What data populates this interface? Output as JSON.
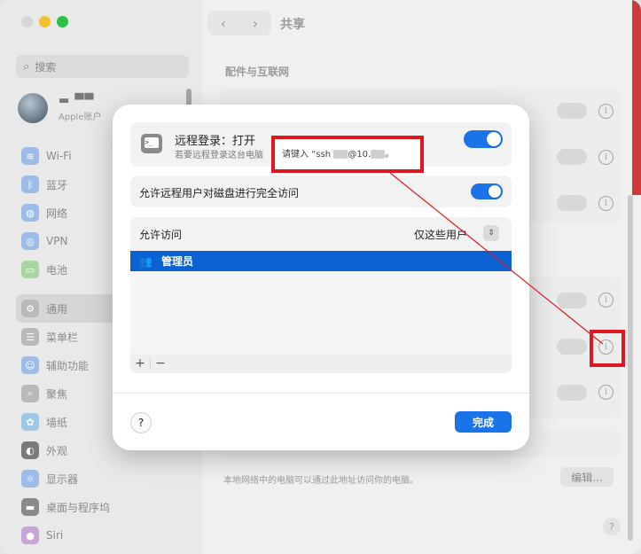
{
  "window": {
    "title": "共享",
    "nav_back": "‹",
    "nav_forward": "›"
  },
  "sidebar": {
    "search_placeholder": "搜索",
    "account_name": "▬ ▀▀",
    "account_sub": "Apple账户",
    "items": [
      {
        "label": "Wi-Fi",
        "icon": "wifi-icon",
        "color": "#9dbde8"
      },
      {
        "label": "蓝牙",
        "icon": "bluetooth-icon",
        "color": "#9dbde8"
      },
      {
        "label": "网络",
        "icon": "globe-icon",
        "color": "#9dbde8"
      },
      {
        "label": "VPN",
        "icon": "vpn-icon",
        "color": "#9dbde8"
      },
      {
        "label": "电池",
        "icon": "battery-icon",
        "color": "#a9d6a0"
      },
      {
        "label": "通用",
        "icon": "gear-icon",
        "color": "#b9b9b9",
        "active": true
      },
      {
        "label": "菜单栏",
        "icon": "menubar-icon",
        "color": "#b9b9b9"
      },
      {
        "label": "辅助功能",
        "icon": "accessibility-icon",
        "color": "#9dbde8"
      },
      {
        "label": "聚焦",
        "icon": "spotlight-icon",
        "color": "#b9b9b9"
      },
      {
        "label": "墙纸",
        "icon": "wallpaper-icon",
        "color": "#9dc9e6"
      },
      {
        "label": "外观",
        "icon": "appearance-icon",
        "color": "#7a7a7a"
      },
      {
        "label": "显示器",
        "icon": "display-icon",
        "color": "#9dbde8"
      },
      {
        "label": "桌面与程序坞",
        "icon": "dock-icon",
        "color": "#8a8a8a"
      },
      {
        "label": "Siri",
        "icon": "siri-icon",
        "color": "#c5a6d6"
      }
    ]
  },
  "main": {
    "section_heading": "配件与互联网",
    "footer_text": "本地网络中的电脑可以通过此地址访问你的电脑。",
    "edit_button": "编辑...",
    "help": "?"
  },
  "dialog": {
    "remote_login_title": "远程登录：打开",
    "remote_login_sub": "若要远程登录这台电脑",
    "full_disk_label": "允许远程用户对磁盘进行完全访问",
    "allow_access_label": "允许访问",
    "allow_access_value": "仅这些用户",
    "users": [
      "管理员"
    ],
    "add_label": "+",
    "remove_label": "−",
    "help_label": "?",
    "done_label": "完成"
  },
  "annotation": {
    "ssh_hint_prefix": "请键入 “ssh",
    "ssh_hint_mid": "@10.",
    "ssh_hint_suffix": "。",
    "box_color": "#e0171f"
  }
}
